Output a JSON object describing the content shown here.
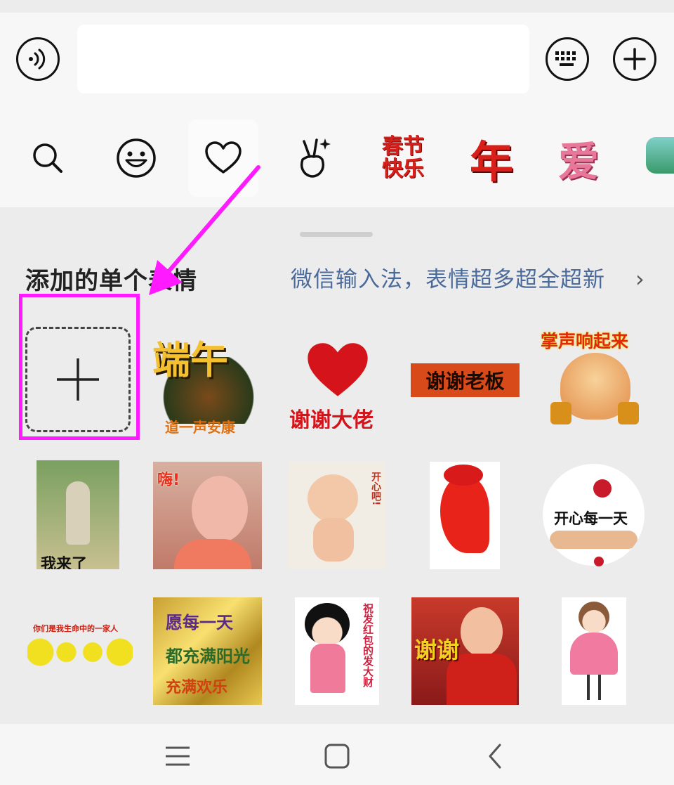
{
  "input_bar": {
    "voice_icon": "voice-icon",
    "keyboard_icon": "keyboard-icon",
    "plus_icon": "plus-circle-icon"
  },
  "tabs": [
    {
      "name": "search",
      "icon": "search-icon"
    },
    {
      "name": "emoji",
      "icon": "smiley-icon"
    },
    {
      "name": "favorites",
      "icon": "heart-icon",
      "active": true
    },
    {
      "name": "gesture",
      "icon": "victory-hand-icon"
    },
    {
      "name": "spring-festival",
      "label": "春节\n快乐"
    },
    {
      "name": "nian",
      "label": "年"
    },
    {
      "name": "ai",
      "label": "爱"
    }
  ],
  "panel": {
    "section_title": "添加的单个表情",
    "promo_text": "微信输入法，表情超多超全超新",
    "promo_chevron": "›"
  },
  "stickers": [
    {
      "text": "端午"
    },
    {
      "text": "道一声安康"
    },
    {
      "text": "谢谢大佬"
    },
    {
      "text": "谢谢老板"
    },
    {
      "text": "掌声响起来"
    },
    {
      "text": "我来了"
    },
    {
      "text": "嗨!"
    },
    {
      "text": "开心吧!"
    },
    {
      "text": "开心每一天"
    },
    {
      "text": "你们是我生命中的一家人"
    },
    {
      "text": "愿每一天"
    },
    {
      "text": "都充满阳光"
    },
    {
      "text": "充满欢乐"
    },
    {
      "text": "祝发红包的发大财"
    },
    {
      "text": "谢谢"
    }
  ],
  "colors": {
    "highlight": "#ff1aff",
    "accent_text": "#4a6a9a"
  },
  "nav": {
    "menu_icon": "menu-icon",
    "home_icon": "home-square-icon",
    "back_icon": "back-chevron-icon"
  }
}
